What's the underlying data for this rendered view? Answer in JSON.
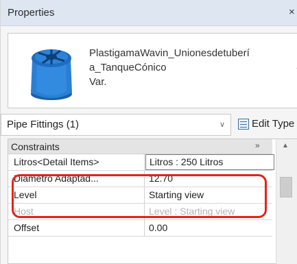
{
  "panel": {
    "title": "Properties",
    "close_glyph": "×"
  },
  "type_selector": {
    "icon": "tank-icon",
    "name_lines": [
      "PlastigamaWavin_Unionesdetuberí",
      "a_TanqueCónico",
      "Var."
    ],
    "arrow_glyph": "⌄"
  },
  "category": {
    "label": "Pipe Fittings (1)",
    "dropdown_glyph": "∨",
    "edit_type_label": "Edit Type"
  },
  "grid": {
    "group_label": "Constraints",
    "collapse_glyph": "»",
    "rows": [
      {
        "name": "Litros<Detail Items>",
        "value": "Litros : 250 Litros",
        "state": "boxed"
      },
      {
        "name": "Diámetro Adaptad...",
        "value": "12.70",
        "state": "normal"
      },
      {
        "name": "Level",
        "value": "Starting view",
        "state": "normal"
      },
      {
        "name": "Host",
        "value": "Level : Starting view",
        "state": "disabled"
      },
      {
        "name": "Offset",
        "value": "0.00",
        "state": "normal"
      }
    ],
    "scroll_up_glyph": "▲"
  },
  "colors": {
    "highlight": "#e2231a",
    "tank_blue": "#2a7fd4",
    "title_bar": "#dde6f1"
  }
}
